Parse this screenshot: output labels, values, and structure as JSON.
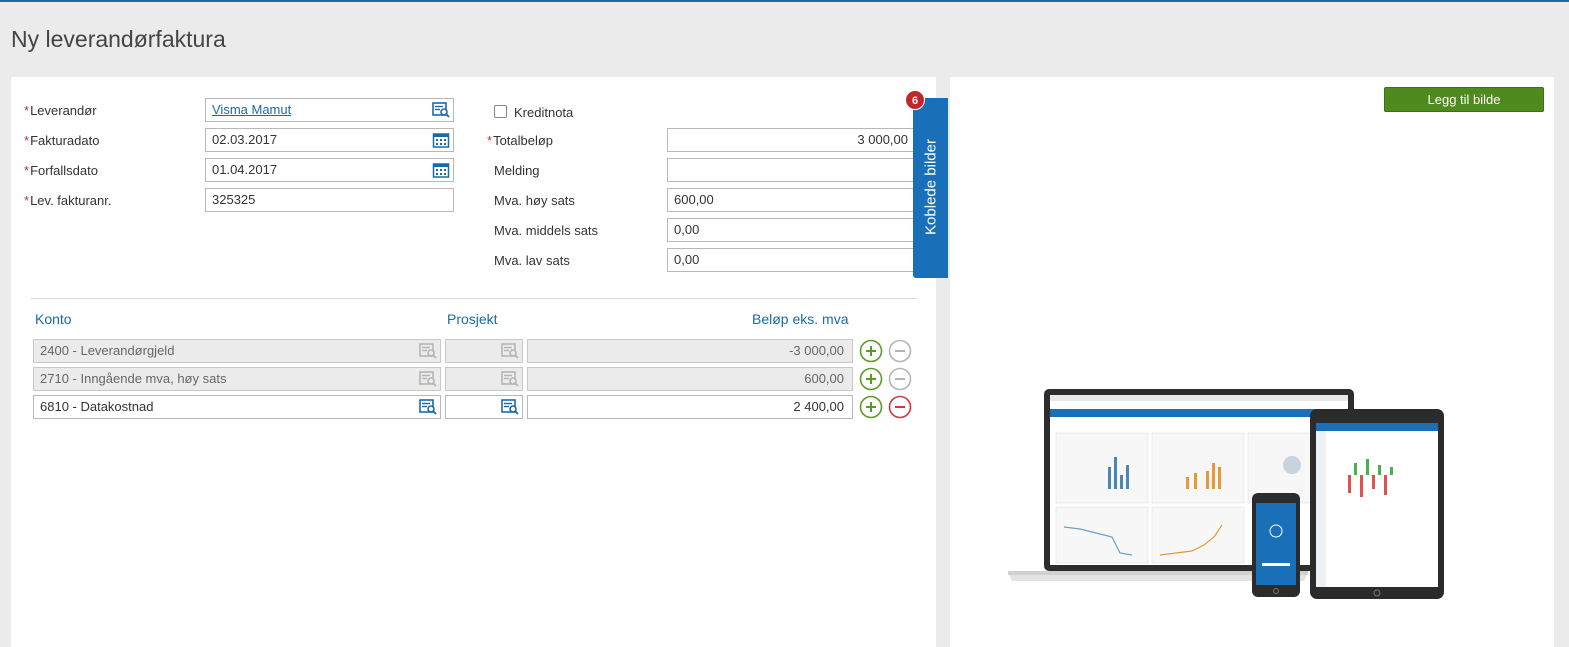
{
  "page": {
    "title": "Ny leverandørfaktura"
  },
  "form": {
    "required_mark": "*",
    "supplier": {
      "label": "Leverandør",
      "value": "Visma Mamut"
    },
    "invoice_date": {
      "label": "Fakturadato",
      "value": "02.03.2017"
    },
    "due_date": {
      "label": "Forfallsdato",
      "value": "01.04.2017"
    },
    "supplier_invoice_no": {
      "label": "Lev. fakturanr.",
      "value": "325325"
    },
    "credit_note": {
      "label": "Kreditnota",
      "checked": false
    },
    "total_amount": {
      "label": "Totalbeløp",
      "value": "3 000,00"
    },
    "message": {
      "label": "Melding",
      "value": ""
    },
    "vat_high": {
      "label": "Mva. høy sats",
      "value": "600,00"
    },
    "vat_medium": {
      "label": "Mva. middels sats",
      "value": "0,00"
    },
    "vat_low": {
      "label": "Mva. lav sats",
      "value": "0,00"
    }
  },
  "lines": {
    "headers": {
      "account": "Konto",
      "project": "Prosjekt",
      "amount": "Beløp eks. mva"
    },
    "rows": [
      {
        "account": "2400 - Leverandørgjeld",
        "project": "",
        "amount": "-3 000,00",
        "editable": false
      },
      {
        "account": "2710 - Inngående mva, høy sats",
        "project": "",
        "amount": "600,00",
        "editable": false
      },
      {
        "account": "6810 - Datakostnad",
        "project": "",
        "amount": "2 400,00",
        "editable": true
      }
    ]
  },
  "side_tab": {
    "label": "Koblede bilder",
    "badge": "6"
  },
  "image_panel": {
    "add_button": "Legg til bilde"
  },
  "colors": {
    "accent_blue": "#1a70b8",
    "green": "#4e8a1e",
    "red": "#c0262d",
    "required": "#c0392b"
  }
}
